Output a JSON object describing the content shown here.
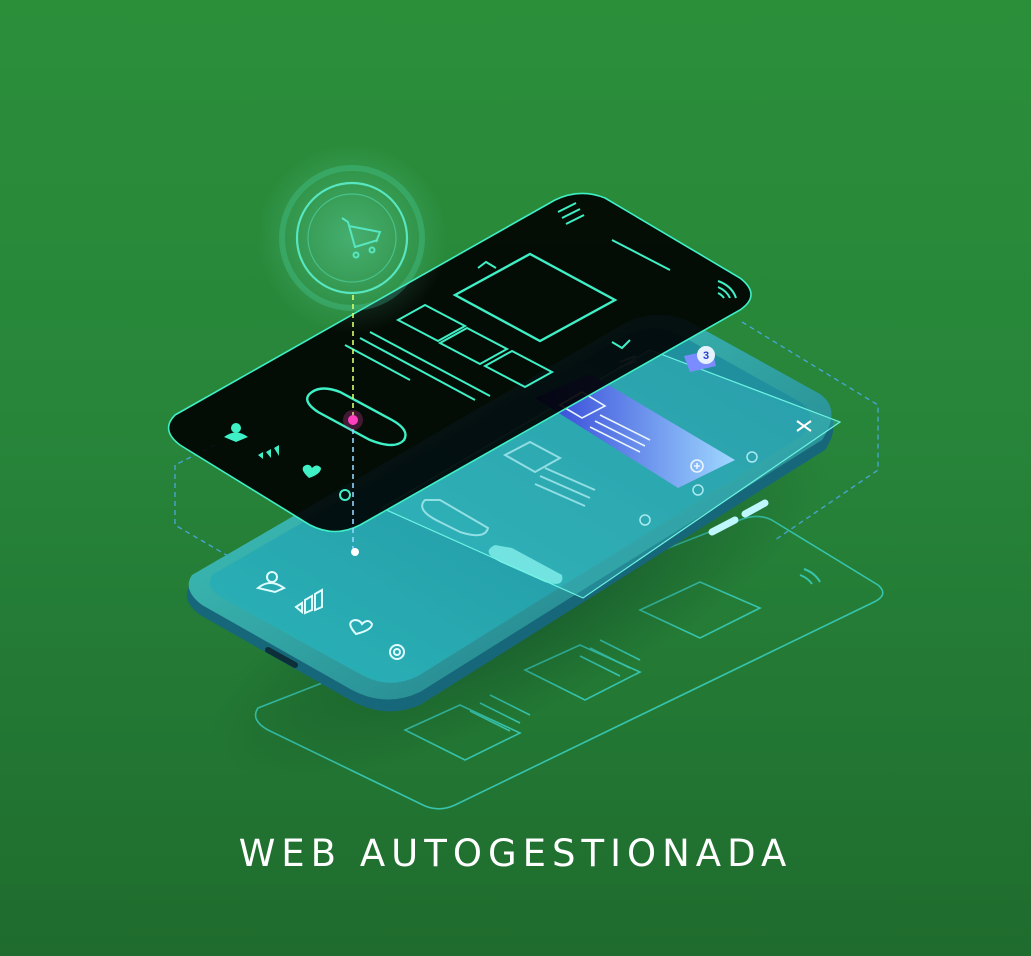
{
  "caption": "WEB AUTOGESTIONADA",
  "cart_badge_count": "3",
  "colors": {
    "background_top": "#2b8f3a",
    "background_bottom": "#1f6c2e",
    "accent_line": "#5ff0c8",
    "phone_body": "#2aa7b0",
    "dark_panel": "#000000",
    "highlight_card": "#3a4bd8"
  },
  "icons": [
    "cart-icon",
    "menu-icon",
    "wifi-icon",
    "user-icon",
    "chart-icon",
    "heart-icon",
    "settings-icon",
    "close-icon",
    "plus-icon"
  ]
}
